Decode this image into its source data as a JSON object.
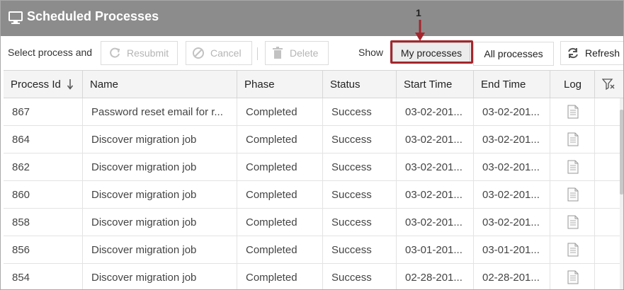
{
  "window": {
    "title": "Scheduled Processes",
    "icon": "monitor-icon"
  },
  "toolbar": {
    "select_label": "Select process and",
    "resubmit_label": "Resubmit",
    "cancel_label": "Cancel",
    "delete_label": "Delete",
    "show_label": "Show",
    "my_processes_label": "My processes",
    "all_processes_label": "All processes",
    "refresh_label": "Refresh"
  },
  "annotation": {
    "number": "1",
    "color": "#a4262c"
  },
  "table": {
    "columns": [
      "Process Id",
      "Name",
      "Phase",
      "Status",
      "Start Time",
      "End Time",
      "Log"
    ],
    "sort_icon": "arrow-down-icon",
    "filter_icon": "filter-icon",
    "rows": [
      {
        "id": "867",
        "name": "Password reset email for r...",
        "phase": "Completed",
        "status": "Success",
        "start": "03-02-201...",
        "end": "03-02-201..."
      },
      {
        "id": "864",
        "name": "Discover migration job",
        "phase": "Completed",
        "status": "Success",
        "start": "03-02-201...",
        "end": "03-02-201..."
      },
      {
        "id": "862",
        "name": "Discover migration job",
        "phase": "Completed",
        "status": "Success",
        "start": "03-02-201...",
        "end": "03-02-201..."
      },
      {
        "id": "860",
        "name": "Discover migration job",
        "phase": "Completed",
        "status": "Success",
        "start": "03-02-201...",
        "end": "03-02-201..."
      },
      {
        "id": "858",
        "name": "Discover migration job",
        "phase": "Completed",
        "status": "Success",
        "start": "03-02-201...",
        "end": "03-02-201..."
      },
      {
        "id": "856",
        "name": "Discover migration job",
        "phase": "Completed",
        "status": "Success",
        "start": "03-01-201...",
        "end": "03-01-201..."
      },
      {
        "id": "854",
        "name": "Discover migration job",
        "phase": "Completed",
        "status": "Success",
        "start": "02-28-201...",
        "end": "02-28-201..."
      }
    ]
  },
  "colors": {
    "titlebar": "#8c8c8c",
    "header_bg": "#f4f4f4",
    "highlight": "#a4262c"
  }
}
